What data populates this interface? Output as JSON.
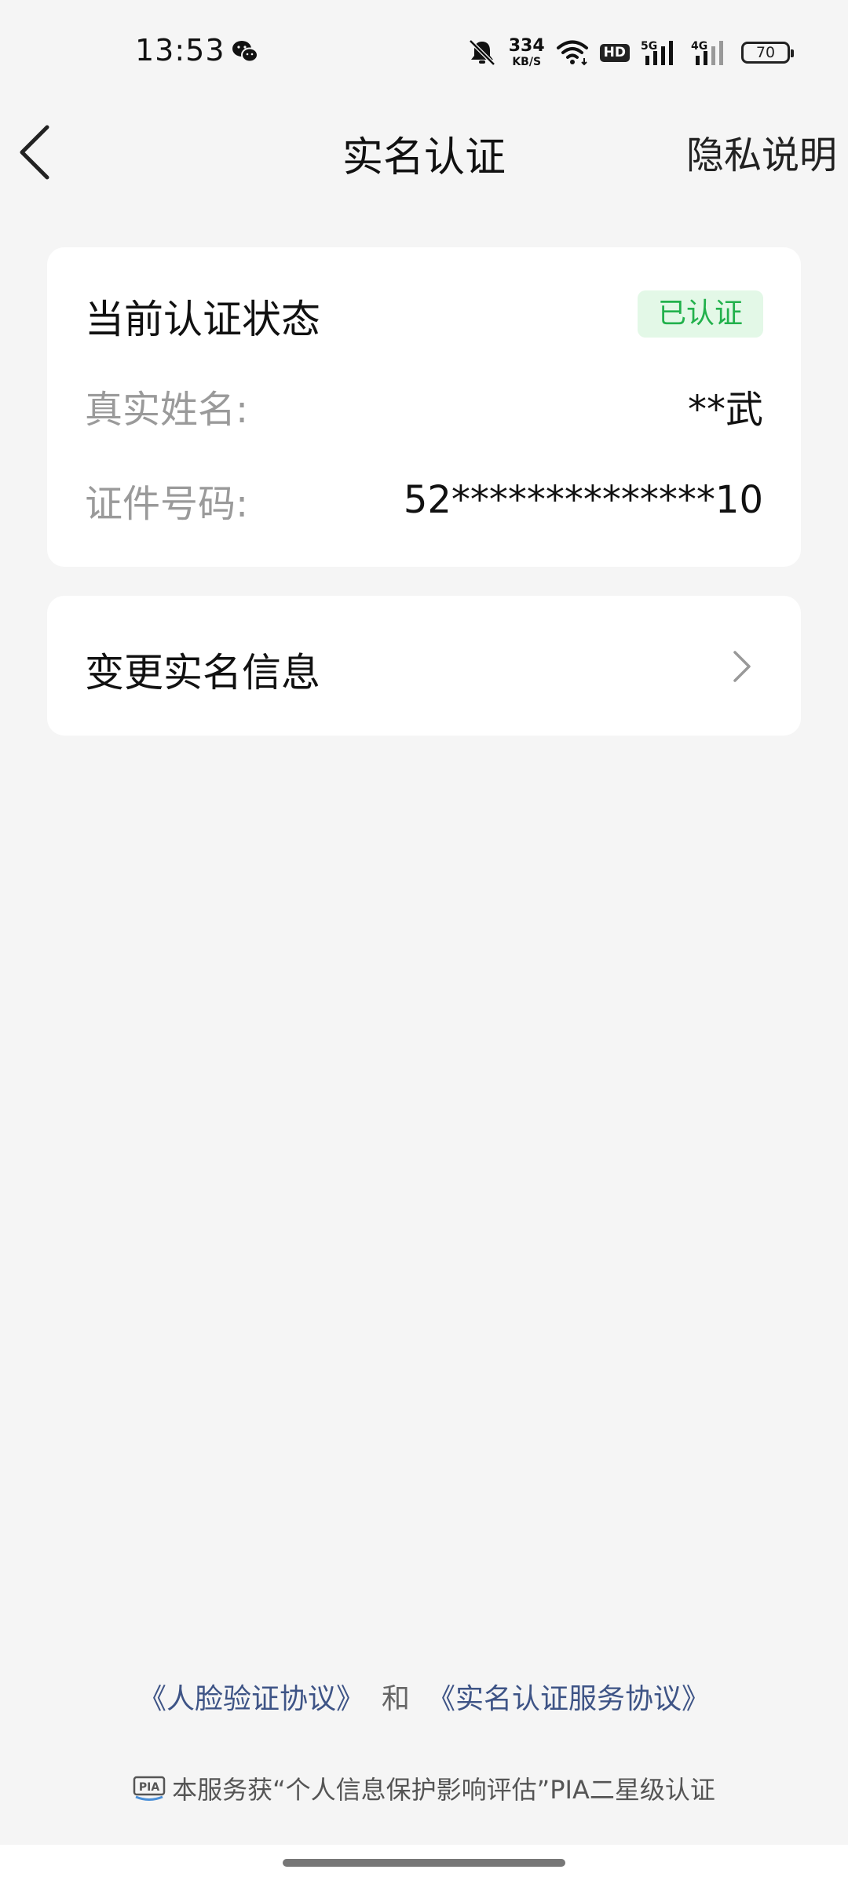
{
  "status_bar": {
    "time": "13:53",
    "net_speed_value": "334",
    "net_speed_unit": "KB/S",
    "hd_label": "HD",
    "sim1_label": "5G",
    "sim2_label": "4G",
    "battery_level": "70",
    "icons": [
      "wechat-icon",
      "mute-icon",
      "wifi-icon",
      "hd-icon",
      "signal-5g-icon",
      "signal-4g-icon",
      "battery-icon"
    ]
  },
  "nav": {
    "title": "实名认证",
    "privacy_label": "隐私说明",
    "back_icon": "back-arrow-icon"
  },
  "status_card": {
    "header": "当前认证状态",
    "badge": "已认证",
    "name_label": "真实姓名:",
    "name_value": "**武",
    "id_label": "证件号码:",
    "id_value": "52**************10"
  },
  "change_card": {
    "label": "变更实名信息",
    "icon": "chevron-right-icon"
  },
  "footer": {
    "face_agreement": "《人脸验证协议》",
    "conjunction": "和",
    "service_agreement": "《实名认证服务协议》",
    "pia_logo_text": "PIA",
    "pia_note": "本服务获“个人信息保护影响评估”PIA二星级认证"
  },
  "colors": {
    "background": "#f5f5f5",
    "card": "#ffffff",
    "badge_bg": "#e3f8e7",
    "badge_text": "#22b14c",
    "link": "#3e5486"
  }
}
